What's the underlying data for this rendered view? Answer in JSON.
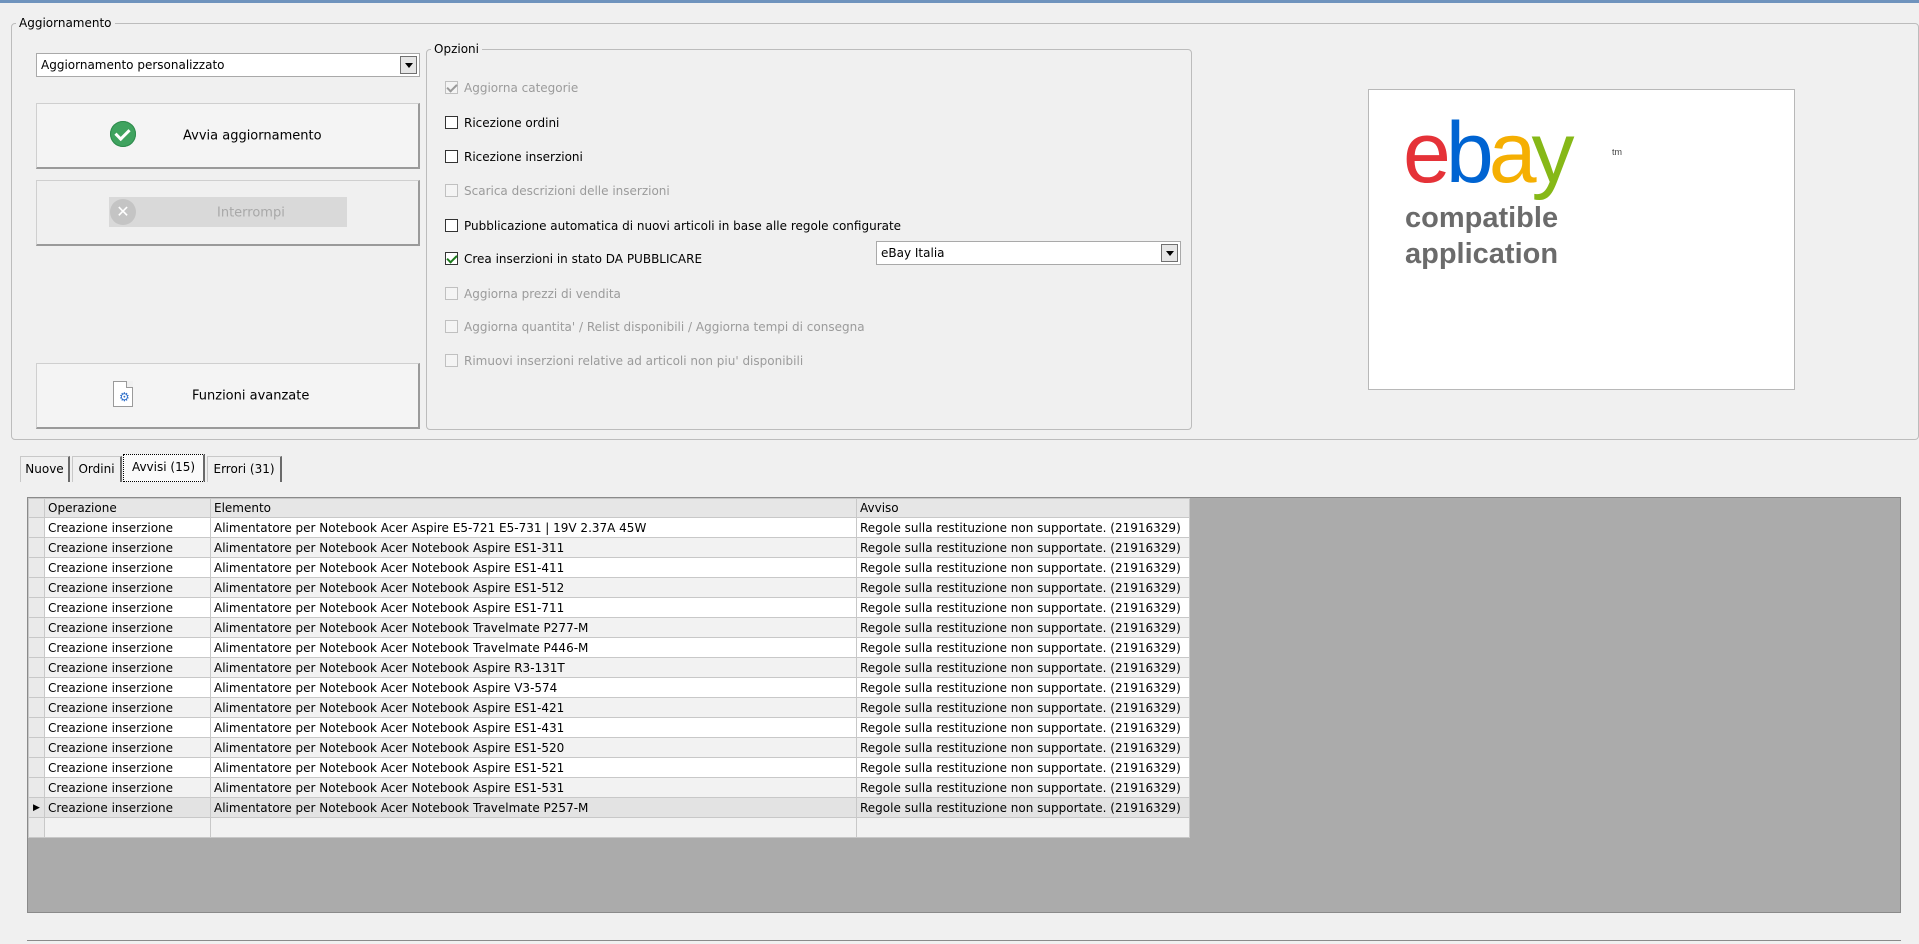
{
  "colors": {
    "accent": "#6f93bd",
    "ok_green": "#3fa35f",
    "grid_bg": "#ababab"
  },
  "update_group": {
    "legend": "Aggiornamento",
    "mode_select": "Aggiornamento personalizzato",
    "start_button": "Avvia aggiornamento",
    "start_icon": "check-circle-icon",
    "stop_button": "Interrompi",
    "stop_icon": "x-circle-icon",
    "advanced_button": "Funzioni avanzate",
    "advanced_icon": "settings-document-icon"
  },
  "options_group": {
    "legend": "Opzioni",
    "options": [
      {
        "label": "Aggiorna categorie",
        "checked": true,
        "enabled": false
      },
      {
        "label": "Ricezione ordini",
        "checked": false,
        "enabled": true
      },
      {
        "label": "Ricezione inserzioni",
        "checked": false,
        "enabled": true
      },
      {
        "label": "Scarica descrizioni delle inserzioni",
        "checked": false,
        "enabled": false
      },
      {
        "label": "Pubblicazione automatica di nuovi articoli in base alle regole configurate",
        "checked": false,
        "enabled": true
      },
      {
        "label": "Crea inserzioni in stato DA PUBBLICARE",
        "checked": true,
        "enabled": true
      },
      {
        "label": "Aggiorna prezzi di vendita",
        "checked": false,
        "enabled": false
      },
      {
        "label": "Aggiorna quantita' / Relist disponibili / Aggiorna tempi di consegna",
        "checked": false,
        "enabled": false
      },
      {
        "label": "Rimuovi inserzioni relative ad articoli non piu' disponibili",
        "checked": false,
        "enabled": false
      }
    ],
    "site_select": "eBay Italia"
  },
  "logo": {
    "line1": "compatible",
    "line2": "application",
    "tm": "tm"
  },
  "tabs": [
    {
      "label": "Nuove",
      "active": false
    },
    {
      "label": "Ordini",
      "active": false
    },
    {
      "label": "Avvisi (15)",
      "active": true
    },
    {
      "label": "Errori (31)",
      "active": false
    }
  ],
  "table": {
    "columns": [
      "Operazione",
      "Elemento",
      "Avviso"
    ],
    "rows": [
      [
        "Creazione inserzione",
        "Alimentatore per Notebook Acer Aspire E5-721 E5-731  | 19V 2.37A 45W",
        "Regole sulla restituzione non supportate. (21916329)"
      ],
      [
        "Creazione inserzione",
        "Alimentatore per Notebook Acer Notebook Aspire ES1-311",
        "Regole sulla restituzione non supportate. (21916329)"
      ],
      [
        "Creazione inserzione",
        "Alimentatore per Notebook Acer Notebook Aspire ES1-411",
        "Regole sulla restituzione non supportate. (21916329)"
      ],
      [
        "Creazione inserzione",
        "Alimentatore per Notebook Acer Notebook Aspire ES1-512",
        "Regole sulla restituzione non supportate. (21916329)"
      ],
      [
        "Creazione inserzione",
        "Alimentatore per Notebook Acer Notebook Aspire ES1-711",
        "Regole sulla restituzione non supportate. (21916329)"
      ],
      [
        "Creazione inserzione",
        "Alimentatore per Notebook Acer Notebook Travelmate P277-M",
        "Regole sulla restituzione non supportate. (21916329)"
      ],
      [
        "Creazione inserzione",
        "Alimentatore per Notebook Acer Notebook Travelmate P446-M",
        "Regole sulla restituzione non supportate. (21916329)"
      ],
      [
        "Creazione inserzione",
        "Alimentatore per Notebook Acer Notebook Aspire R3-131T",
        "Regole sulla restituzione non supportate. (21916329)"
      ],
      [
        "Creazione inserzione",
        "Alimentatore per Notebook Acer Notebook Aspire V3-574",
        "Regole sulla restituzione non supportate. (21916329)"
      ],
      [
        "Creazione inserzione",
        "Alimentatore per Notebook Acer Notebook Aspire ES1-421",
        "Regole sulla restituzione non supportate. (21916329)"
      ],
      [
        "Creazione inserzione",
        "Alimentatore per Notebook Acer Notebook Aspire ES1-431",
        "Regole sulla restituzione non supportate. (21916329)"
      ],
      [
        "Creazione inserzione",
        "Alimentatore per Notebook Acer Notebook Aspire ES1-520",
        "Regole sulla restituzione non supportate. (21916329)"
      ],
      [
        "Creazione inserzione",
        "Alimentatore per Notebook Acer Notebook Aspire ES1-521",
        "Regole sulla restituzione non supportate. (21916329)"
      ],
      [
        "Creazione inserzione",
        "Alimentatore per Notebook Acer Notebook Aspire ES1-531",
        "Regole sulla restituzione non supportate. (21916329)"
      ],
      [
        "Creazione inserzione",
        "Alimentatore per Notebook Acer Notebook Travelmate P257-M",
        "Regole sulla restituzione non supportate. (21916329)"
      ]
    ],
    "current_row_index": 14
  }
}
